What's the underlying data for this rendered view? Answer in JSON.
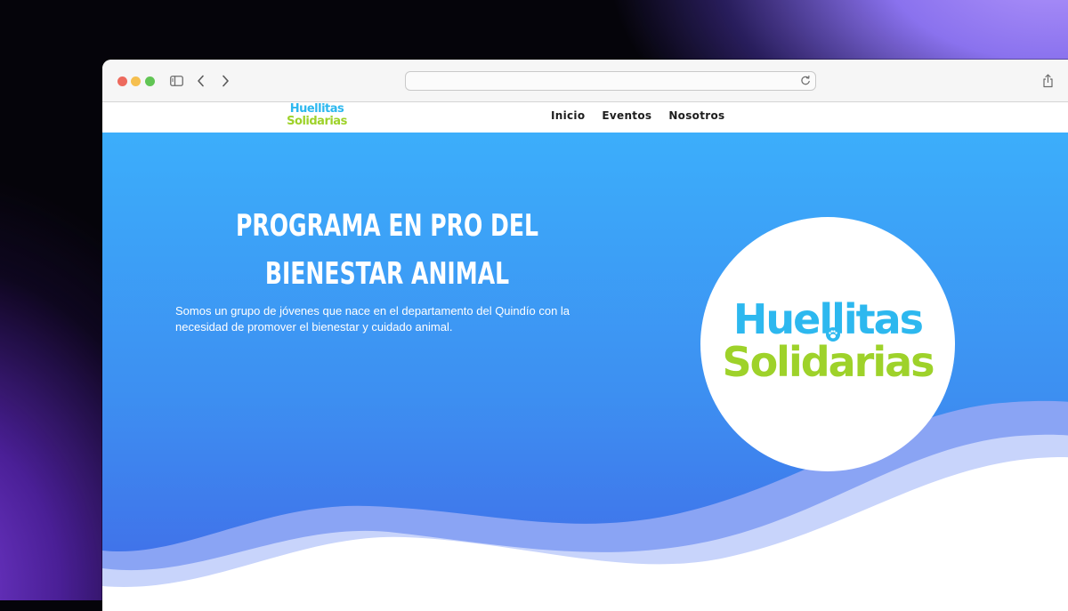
{
  "browser": {
    "address_value": "",
    "icons": [
      "sidebar-icon",
      "back-chevron-icon",
      "forward-chevron-icon",
      "reload-icon",
      "share-icon"
    ]
  },
  "nav": {
    "logo_line1": "Huellitas",
    "logo_line2": "Solidarias",
    "links": [
      "Inicio",
      "Eventos",
      "Nosotros"
    ]
  },
  "hero": {
    "title": "PROGRAMA EN PRO DEL BIENESTAR ANIMAL",
    "description": "Somos un grupo de jóvenes que nace en el departamento del Quindío con la necesidad de promover el bienestar y cuidado animal.",
    "logo_line1": "Huellitas",
    "logo_line2": "Solidarias"
  },
  "colors": {
    "brand_blue": "#2db8ef",
    "brand_green": "#9ed22a",
    "hero_top": "#3caefb",
    "hero_bottom": "#4169e7"
  }
}
